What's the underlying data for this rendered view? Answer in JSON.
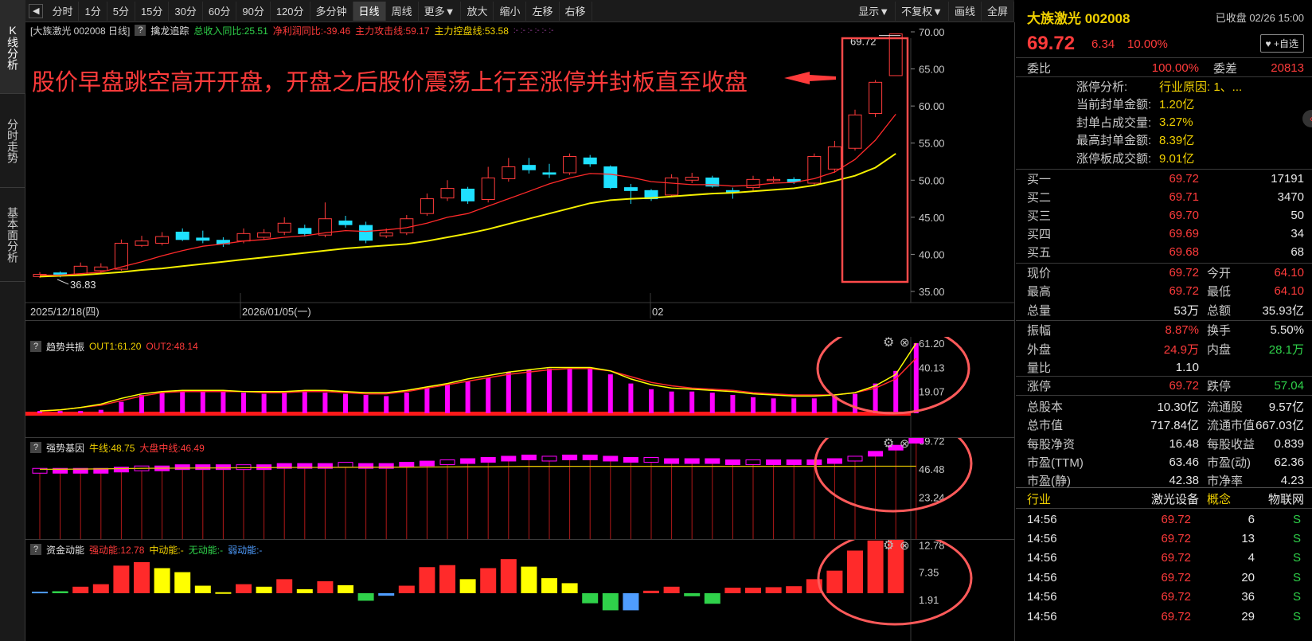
{
  "rail": {
    "tabs": [
      "K线分析",
      "分时走势",
      "基本面分析"
    ]
  },
  "toolbar": {
    "arrow_icon": "◀",
    "periods": [
      "分时",
      "1分",
      "5分",
      "15分",
      "30分",
      "60分",
      "90分",
      "120分",
      "多分钟",
      "日线",
      "周线",
      "更多▼",
      "放大",
      "缩小",
      "左移",
      "右移"
    ],
    "active_period": "日线",
    "right": [
      "显示▼",
      "不复权▼",
      "画线",
      "全屏"
    ]
  },
  "main": {
    "title": "[大族激光 002008 日线]",
    "indicator_name": "擒龙追踪",
    "ind1": "总收入同比:25.51",
    "ind2": "净利润同比:-39.46",
    "ind3": "主力攻击线:59.17",
    "ind4": "主力控盘线:53.58",
    "dots": ":- :- :- :- :- :-",
    "annotation": "股价早盘跳空高开开盘，开盘之后股价震荡上行至涨停并封板直至收盘",
    "high_label": "69.72",
    "low_label": "36.83",
    "y_ticks": [
      "70.00",
      "65.00",
      "60.00",
      "55.00",
      "50.00",
      "45.00",
      "40.00",
      "35.00"
    ],
    "dates": [
      "2025/12/18(四)",
      "2026/01/05(一)",
      "02"
    ],
    "colors": {
      "up": "#ff3b3b",
      "down": "#1fe0ff",
      "ma_fast": "#ff2a2a",
      "ma_slow": "#f5f000",
      "annotation": "#ff3b3b"
    }
  },
  "chart_data": [
    {
      "type": "candlestick",
      "title": "[大族激光 002008 日线]",
      "ylim": [
        35,
        70
      ],
      "candles": [
        {
          "o": 37.0,
          "c": 37.3,
          "h": 37.6,
          "l": 36.83
        },
        {
          "o": 37.5,
          "c": 37.1,
          "h": 37.7,
          "l": 36.9
        },
        {
          "o": 37.3,
          "c": 38.4,
          "h": 38.9,
          "l": 37.1
        },
        {
          "o": 37.8,
          "c": 38.3,
          "h": 38.8,
          "l": 37.6
        },
        {
          "o": 38.0,
          "c": 41.5,
          "h": 42.0,
          "l": 37.8
        },
        {
          "o": 41.2,
          "c": 41.8,
          "h": 42.5,
          "l": 41.0
        },
        {
          "o": 41.5,
          "c": 42.4,
          "h": 43.0,
          "l": 41.2
        },
        {
          "o": 43.0,
          "c": 42.0,
          "h": 43.5,
          "l": 41.8
        },
        {
          "o": 42.2,
          "c": 41.9,
          "h": 43.2,
          "l": 41.5
        },
        {
          "o": 41.9,
          "c": 41.4,
          "h": 42.3,
          "l": 41.0
        },
        {
          "o": 41.8,
          "c": 42.8,
          "h": 43.5,
          "l": 41.5
        },
        {
          "o": 42.3,
          "c": 42.9,
          "h": 43.4,
          "l": 42.0
        },
        {
          "o": 43.0,
          "c": 44.2,
          "h": 45.0,
          "l": 42.6
        },
        {
          "o": 43.5,
          "c": 42.8,
          "h": 44.0,
          "l": 42.4
        },
        {
          "o": 42.6,
          "c": 44.8,
          "h": 47.0,
          "l": 42.3
        },
        {
          "o": 44.5,
          "c": 44.0,
          "h": 45.2,
          "l": 43.6
        },
        {
          "o": 43.9,
          "c": 41.9,
          "h": 44.4,
          "l": 41.5
        },
        {
          "o": 42.5,
          "c": 42.9,
          "h": 43.5,
          "l": 42.2
        },
        {
          "o": 42.9,
          "c": 44.8,
          "h": 45.3,
          "l": 42.6
        },
        {
          "o": 45.5,
          "c": 47.5,
          "h": 48.2,
          "l": 45.2
        },
        {
          "o": 47.6,
          "c": 48.9,
          "h": 50.0,
          "l": 47.2
        },
        {
          "o": 48.8,
          "c": 47.2,
          "h": 49.1,
          "l": 46.8
        },
        {
          "o": 47.4,
          "c": 50.3,
          "h": 51.8,
          "l": 47.0
        },
        {
          "o": 50.2,
          "c": 51.8,
          "h": 53.0,
          "l": 49.8
        },
        {
          "o": 52.0,
          "c": 51.4,
          "h": 53.0,
          "l": 50.9
        },
        {
          "o": 51.0,
          "c": 50.8,
          "h": 52.2,
          "l": 50.3
        },
        {
          "o": 51.0,
          "c": 53.2,
          "h": 53.6,
          "l": 50.7
        },
        {
          "o": 53.0,
          "c": 52.2,
          "h": 53.4,
          "l": 51.8
        },
        {
          "o": 51.8,
          "c": 49.0,
          "h": 52.0,
          "l": 48.8
        },
        {
          "o": 49.0,
          "c": 48.6,
          "h": 49.5,
          "l": 46.8
        },
        {
          "o": 48.6,
          "c": 47.5,
          "h": 48.8,
          "l": 47.2
        },
        {
          "o": 48.0,
          "c": 50.3,
          "h": 50.8,
          "l": 47.7
        },
        {
          "o": 50.0,
          "c": 50.4,
          "h": 51.0,
          "l": 49.6
        },
        {
          "o": 50.3,
          "c": 49.2,
          "h": 50.6,
          "l": 49.0
        },
        {
          "o": 48.6,
          "c": 48.4,
          "h": 49.0,
          "l": 47.5
        },
        {
          "o": 49.0,
          "c": 50.1,
          "h": 50.6,
          "l": 48.6
        },
        {
          "o": 50.0,
          "c": 50.1,
          "h": 50.5,
          "l": 49.7
        },
        {
          "o": 50.1,
          "c": 49.8,
          "h": 50.4,
          "l": 49.5
        },
        {
          "o": 49.6,
          "c": 53.2,
          "h": 53.6,
          "l": 49.3
        },
        {
          "o": 51.5,
          "c": 54.5,
          "h": 55.3,
          "l": 51.0
        },
        {
          "o": 54.3,
          "c": 58.8,
          "h": 59.5,
          "l": 54.0
        },
        {
          "o": 59.0,
          "c": 63.2,
          "h": 63.5,
          "l": 58.5
        },
        {
          "o": 64.1,
          "c": 69.72,
          "h": 69.72,
          "l": 64.1
        }
      ],
      "ma_fast": [
        37.2,
        37.2,
        37.4,
        37.6,
        38.3,
        39.0,
        39.8,
        40.5,
        41.1,
        41.4,
        41.8,
        42.0,
        42.3,
        42.5,
        42.9,
        43.2,
        43.1,
        43.3,
        43.6,
        44.2,
        45.0,
        45.5,
        46.5,
        47.5,
        48.5,
        49.5,
        50.3,
        50.9,
        50.8,
        50.4,
        49.8,
        49.6,
        49.4,
        49.4,
        49.2,
        49.3,
        49.6,
        49.7,
        50.2,
        51.1,
        52.8,
        55.4,
        58.9
      ],
      "ma_slow": [
        37.0,
        37.1,
        37.2,
        37.4,
        37.6,
        37.9,
        38.1,
        38.4,
        38.7,
        39.0,
        39.3,
        39.6,
        39.9,
        40.2,
        40.5,
        40.8,
        41.0,
        41.2,
        41.4,
        41.8,
        42.3,
        42.8,
        43.4,
        44.1,
        44.8,
        45.5,
        46.2,
        46.9,
        47.3,
        47.5,
        47.6,
        47.8,
        48.0,
        48.2,
        48.3,
        48.5,
        48.7,
        48.9,
        49.3,
        49.9,
        50.6,
        51.7,
        53.58
      ]
    },
    {
      "type": "bar",
      "title": "趋势共振",
      "ylim": [
        0,
        64
      ],
      "y_ticks": [
        "61.20",
        "40.13",
        "19.07"
      ],
      "series": [
        {
          "name": "OUT1",
          "label": "OUT1:61.20",
          "values": [
            2,
            2,
            2,
            3,
            10,
            16,
            18,
            19,
            19,
            19,
            18,
            17,
            18,
            19,
            18,
            17,
            16,
            15,
            18,
            22,
            25,
            28,
            31,
            36,
            38,
            39,
            39,
            40,
            34,
            26,
            21,
            19,
            19,
            18,
            16,
            14,
            13,
            13,
            13,
            15,
            17,
            26,
            37,
            61.2
          ]
        },
        {
          "name": "OUT2",
          "label": "OUT2:48.14",
          "values": []
        }
      ],
      "line_out1": [
        2,
        3,
        5,
        8,
        13,
        17,
        19,
        20,
        20,
        20,
        19,
        19,
        19,
        20,
        20,
        19,
        18,
        18,
        20,
        23,
        26,
        30,
        33,
        36,
        38,
        40,
        40,
        40,
        37,
        30,
        25,
        22,
        21,
        20,
        19,
        17,
        16,
        15,
        15,
        16,
        18,
        24,
        34,
        61.2
      ],
      "line_out2": [
        2,
        3,
        5,
        7,
        11,
        15,
        18,
        19,
        19,
        19,
        19,
        18,
        18,
        19,
        19,
        18,
        17,
        17,
        19,
        22,
        25,
        28,
        31,
        34,
        36,
        38,
        39,
        39,
        37,
        32,
        27,
        24,
        22,
        21,
        20,
        18,
        17,
        16,
        16,
        16,
        18,
        22,
        30,
        48.14
      ]
    },
    {
      "type": "bar",
      "title": "强势基因",
      "ylim": [
        0,
        72
      ],
      "y_ticks": [
        "69.72",
        "46.48",
        "23.24"
      ],
      "series": [
        {
          "name": "牛线",
          "label": "牛线:48.75"
        },
        {
          "name": "大盘中线",
          "label": "大盘中线:46.49"
        }
      ],
      "blocks": [
        45,
        45,
        45,
        45,
        46,
        47,
        47,
        48,
        48,
        48,
        48,
        48,
        49,
        49,
        49,
        50,
        49,
        49,
        50,
        51,
        52,
        53,
        54,
        55,
        56,
        55,
        56,
        56,
        55,
        54,
        54,
        53,
        53,
        53,
        52,
        52,
        52,
        52,
        52,
        53,
        55,
        59,
        64,
        69.72
      ],
      "line": [
        46.2,
        46.3,
        46.4,
        46.6,
        46.8,
        47.0,
        47.1,
        47.2,
        47.3,
        47.4,
        47.5,
        47.6,
        47.7,
        47.8,
        47.8,
        47.9,
        47.9,
        48.0,
        48.0,
        48.1,
        48.2,
        48.3,
        48.4,
        48.5,
        48.6,
        48.6,
        48.7,
        48.7,
        48.7,
        48.7,
        48.7,
        48.7,
        48.7,
        48.7,
        48.7,
        48.7,
        48.7,
        48.7,
        48.7,
        48.7,
        48.7,
        48.75,
        48.75,
        48.75
      ]
    },
    {
      "type": "bar",
      "title": "资金动能",
      "ylim": [
        0,
        13
      ],
      "y_ticks": [
        "12.78",
        "7.35",
        "1.91"
      ],
      "series": [
        {
          "name": "强动能",
          "label": "强动能:12.78"
        },
        {
          "name": "中动能",
          "label": "中动能:-"
        },
        {
          "name": "无动能",
          "label": "无动能:-"
        },
        {
          "name": "弱动能",
          "label": "弱动能:-"
        }
      ],
      "bars": [
        {
          "v": 0.3,
          "c": "#4f9dff"
        },
        {
          "v": 0.4,
          "c": "#2fd14a"
        },
        {
          "v": 1.3,
          "c": "#ff2a2a"
        },
        {
          "v": 1.8,
          "c": "#ff2a2a"
        },
        {
          "v": 5.5,
          "c": "#ff2a2a"
        },
        {
          "v": 6.2,
          "c": "#ff2a2a"
        },
        {
          "v": 5.0,
          "c": "#ffff00"
        },
        {
          "v": 4.2,
          "c": "#ffff00"
        },
        {
          "v": 1.5,
          "c": "#ffff00"
        },
        {
          "v": 0.2,
          "c": "#ffff00"
        },
        {
          "v": 1.8,
          "c": "#ff2a2a"
        },
        {
          "v": 1.3,
          "c": "#ffff00"
        },
        {
          "v": 2.8,
          "c": "#ff2a2a"
        },
        {
          "v": 0.8,
          "c": "#ffff00"
        },
        {
          "v": 2.4,
          "c": "#ff2a2a"
        },
        {
          "v": 1.6,
          "c": "#ffff00"
        },
        {
          "v": -1.5,
          "c": "#2fd14a"
        },
        {
          "v": -0.5,
          "c": "#4f9dff"
        },
        {
          "v": 1.5,
          "c": "#ff2a2a"
        },
        {
          "v": 5.2,
          "c": "#ff2a2a"
        },
        {
          "v": 5.6,
          "c": "#ff2a2a"
        },
        {
          "v": 2.8,
          "c": "#ffff00"
        },
        {
          "v": 5.0,
          "c": "#ff2a2a"
        },
        {
          "v": 6.8,
          "c": "#ff2a2a"
        },
        {
          "v": 5.3,
          "c": "#ffff00"
        },
        {
          "v": 3.0,
          "c": "#ffff00"
        },
        {
          "v": 2.0,
          "c": "#ffff00"
        },
        {
          "v": -2.0,
          "c": "#2fd14a"
        },
        {
          "v": -3.4,
          "c": "#2fd14a"
        },
        {
          "v": -3.4,
          "c": "#4f9dff"
        },
        {
          "v": 0.5,
          "c": "#ff2a2a"
        },
        {
          "v": 1.3,
          "c": "#ff2a2a"
        },
        {
          "v": -0.6,
          "c": "#2fd14a"
        },
        {
          "v": -2.1,
          "c": "#2fd14a"
        },
        {
          "v": 1.1,
          "c": "#ff2a2a"
        },
        {
          "v": 1.1,
          "c": "#ff2a2a"
        },
        {
          "v": 1.2,
          "c": "#ff2a2a"
        },
        {
          "v": 1.4,
          "c": "#ff2a2a"
        },
        {
          "v": 2.8,
          "c": "#ff2a2a"
        },
        {
          "v": 4.5,
          "c": "#ff2a2a"
        },
        {
          "v": 8.5,
          "c": "#ff2a2a"
        },
        {
          "v": 10.5,
          "c": "#ff2a2a"
        },
        {
          "v": 12.78,
          "c": "#ff2a2a"
        }
      ]
    }
  ],
  "panels": {
    "p2": {
      "name": "趋势共振",
      "l1": "OUT1:61.20",
      "l2": "OUT2:48.14"
    },
    "p3": {
      "name": "强势基因",
      "l1": "牛线:48.75",
      "l2": "大盘中线:46.49"
    },
    "p4": {
      "name": "资金动能",
      "l1": "强动能:12.78",
      "l2": "中动能:-",
      "l3": "无动能:-",
      "l4": "弱动能:-"
    }
  },
  "quote": {
    "name": "大族激光 002008",
    "status": "已收盘 02/26 15:00",
    "price": "69.72",
    "change": "6.34",
    "pct": "10.00%",
    "watch_button": "♥ +自选",
    "wb_label": "委比",
    "wb_value": "100.00%",
    "wc_label": "委差",
    "wc_value": "20813",
    "limit_analysis": [
      {
        "k": "涨停分析:",
        "v": "行业原因: 1、..."
      },
      {
        "k": "当前封单金额:",
        "v": "1.20亿"
      },
      {
        "k": "封单占成交量:",
        "v": "3.27%"
      },
      {
        "k": "最高封单金额:",
        "v": "8.39亿"
      },
      {
        "k": "涨停板成交额:",
        "v": "9.01亿"
      }
    ],
    "bids": [
      {
        "k": "买一",
        "p": "69.72",
        "v": "17191"
      },
      {
        "k": "买二",
        "p": "69.71",
        "v": "3470"
      },
      {
        "k": "买三",
        "p": "69.70",
        "v": "50"
      },
      {
        "k": "买四",
        "p": "69.69",
        "v": "34"
      },
      {
        "k": "买五",
        "p": "69.68",
        "v": "68"
      }
    ],
    "stats": [
      {
        "k1": "现价",
        "v1": "69.72",
        "c1": "red",
        "k2": "今开",
        "v2": "64.10",
        "c2": "red"
      },
      {
        "k1": "最高",
        "v1": "69.72",
        "c1": "red",
        "k2": "最低",
        "v2": "64.10",
        "c2": "red"
      },
      {
        "k1": "总量",
        "v1": "53万",
        "c1": "wht",
        "k2": "总额",
        "v2": "35.93亿",
        "c2": "wht"
      },
      {
        "k1": "振幅",
        "v1": "8.87%",
        "c1": "red",
        "k2": "换手",
        "v2": "5.50%",
        "c2": "wht"
      },
      {
        "k1": "外盘",
        "v1": "24.9万",
        "c1": "red",
        "k2": "内盘",
        "v2": "28.1万",
        "c2": "grn"
      },
      {
        "k1": "量比",
        "v1": "1.10",
        "c1": "wht",
        "k2": "",
        "v2": "",
        "c2": "wht"
      },
      {
        "k1": "涨停",
        "v1": "69.72",
        "c1": "red",
        "k2": "跌停",
        "v2": "57.04",
        "c2": "grn"
      },
      {
        "k1": "总股本",
        "v1": "10.30亿",
        "c1": "wht",
        "k2": "流通股",
        "v2": "9.57亿",
        "c2": "wht"
      },
      {
        "k1": "总市值",
        "v1": "717.84亿",
        "c1": "wht",
        "k2": "流通市值",
        "v2": "667.03亿",
        "c2": "wht"
      },
      {
        "k1": "每股净资",
        "v1": "16.48",
        "c1": "wht",
        "k2": "每股收益",
        "v2": "0.839",
        "c2": "wht"
      },
      {
        "k1": "市盈(TTM)",
        "v1": "63.46",
        "c1": "wht",
        "k2": "市盈(动)",
        "v2": "62.36",
        "c2": "wht"
      },
      {
        "k1": "市盈(静)",
        "v1": "42.38",
        "c1": "wht",
        "k2": "市净率",
        "v2": "4.23",
        "c2": "wht"
      }
    ],
    "industry_label": "行业",
    "industry": "激光设备",
    "concept_label": "概念",
    "concept": "物联网",
    "ticks": [
      {
        "t": "14:56",
        "p": "69.72",
        "v": "6",
        "s": "S"
      },
      {
        "t": "14:56",
        "p": "69.72",
        "v": "13",
        "s": "S"
      },
      {
        "t": "14:56",
        "p": "69.72",
        "v": "4",
        "s": "S"
      },
      {
        "t": "14:56",
        "p": "69.72",
        "v": "20",
        "s": "S"
      },
      {
        "t": "14:56",
        "p": "69.72",
        "v": "36",
        "s": "S"
      },
      {
        "t": "14:56",
        "p": "69.72",
        "v": "29",
        "s": "S"
      }
    ]
  }
}
